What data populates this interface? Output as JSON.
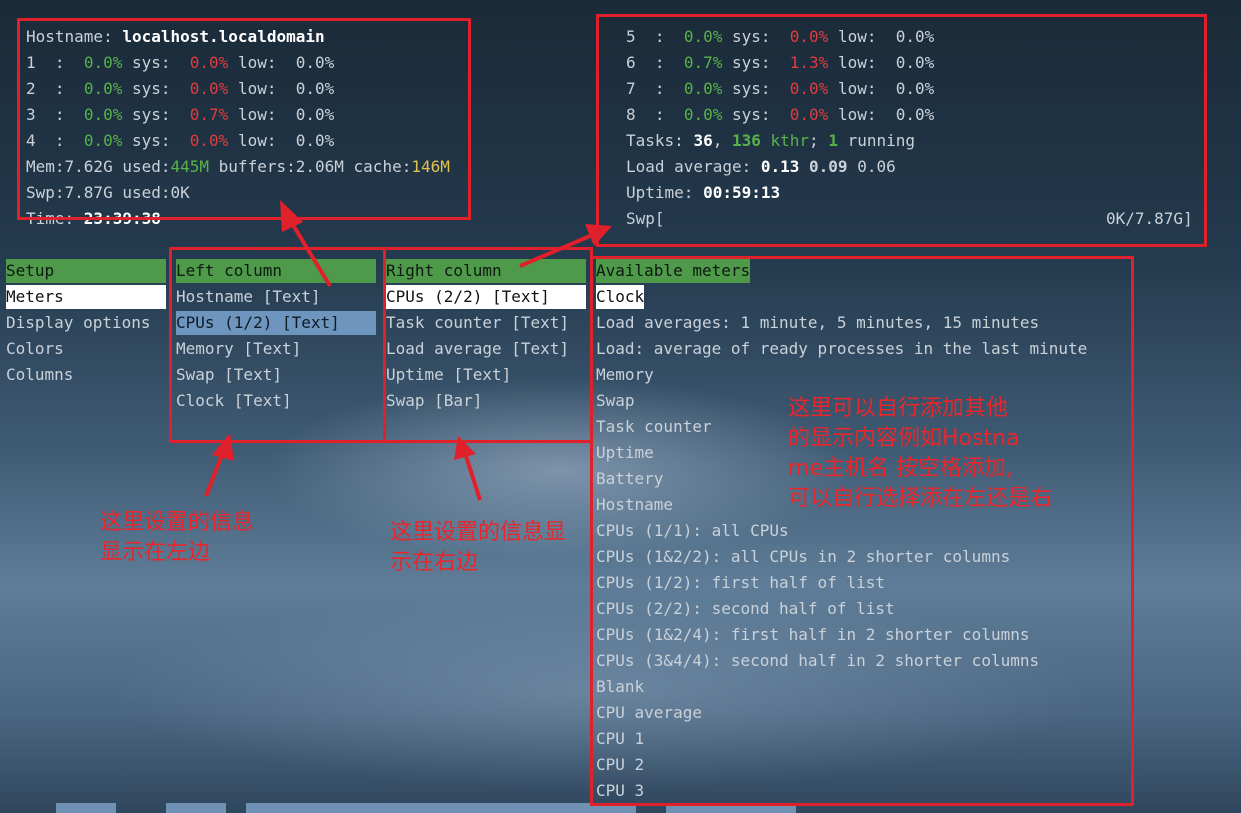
{
  "header_left": {
    "hostname_label": "Hostname: ",
    "hostname": "localhost.localdomain",
    "cpus": [
      {
        "id": "1",
        "usr": "0.0%",
        "sys": "0.0%",
        "low": "0.0%"
      },
      {
        "id": "2",
        "usr": "0.0%",
        "sys": "0.0%",
        "low": "0.0%"
      },
      {
        "id": "3",
        "usr": "0.0%",
        "sys": "0.7%",
        "low": "0.0%"
      },
      {
        "id": "4",
        "usr": "0.0%",
        "sys": "0.0%",
        "low": "0.0%"
      }
    ],
    "mem": {
      "label": "Mem:",
      "total": "7.62G",
      "used_label": " used:",
      "used": "445M",
      "buffers_label": " buffers:",
      "buffers": "2.06M",
      "cache_label": " cache:",
      "cache": "146M"
    },
    "swp": {
      "label": "Swp:",
      "total": "7.87G",
      "used_label": " used:",
      "used": "0K"
    },
    "time": {
      "label": "Time: ",
      "value": "23:39:38"
    }
  },
  "header_right": {
    "cpus": [
      {
        "id": "5",
        "usr": "0.0%",
        "sys": "0.0%",
        "low": "0.0%"
      },
      {
        "id": "6",
        "usr": "0.7%",
        "sys": "1.3%",
        "low": "0.0%"
      },
      {
        "id": "7",
        "usr": "0.0%",
        "sys": "0.0%",
        "low": "0.0%"
      },
      {
        "id": "8",
        "usr": "0.0%",
        "sys": "0.0%",
        "low": "0.0%"
      }
    ],
    "tasks": {
      "label": "Tasks: ",
      "count": "36",
      "sep": ", ",
      "kthr": "136",
      "kthr_label": " kthr",
      "semi": "; ",
      "running": "1",
      "running_label": " running"
    },
    "load": {
      "label": "Load average: ",
      "v1": "0.13",
      "v2": "0.09",
      "v3": "0.06"
    },
    "uptime": {
      "label": "Uptime: ",
      "value": "00:59:13"
    },
    "swp_bar": {
      "label": "Swp[",
      "value": "0K/7.87G]"
    }
  },
  "cpu_labels": {
    "sep": "  :  ",
    "sys": " sys:  ",
    "low": " low:  "
  },
  "setup": {
    "header": "Setup",
    "items": [
      "Meters",
      "Display options",
      "Colors",
      "Columns"
    ]
  },
  "left_column": {
    "header": "Left column",
    "items": [
      "Hostname [Text]",
      "CPUs (1/2) [Text]",
      "Memory [Text]",
      "Swap [Text]",
      "Clock [Text]"
    ]
  },
  "right_column": {
    "header": "Right column",
    "items": [
      "CPUs (2/2) [Text]",
      "Task counter [Text]",
      "Load average [Text]",
      "Uptime [Text]",
      "Swap [Bar]"
    ]
  },
  "available": {
    "header": "Available meters",
    "items": [
      "Clock",
      "Load averages: 1 minute, 5 minutes, 15 minutes",
      "Load: average of ready processes in the last minute",
      "Memory",
      "Swap",
      "Task counter",
      "Uptime",
      "Battery",
      "Hostname",
      "CPUs (1/1): all CPUs",
      "CPUs (1&2/2): all CPUs in 2 shorter columns",
      "CPUs (1/2): first half of list",
      "CPUs (2/2): second half of list",
      "CPUs (1&2/4): first half in 2 shorter columns",
      "CPUs (3&4/4): second half in 2 shorter columns",
      "Blank",
      "CPU average",
      "CPU 1",
      "CPU 2",
      "CPU 3"
    ]
  },
  "annotations": {
    "left_note": "这里设置的信息\n显示在左边",
    "right_note": "这里设置的信息显\n示在右边",
    "meters_note": "这里可以自行添加其他\n的显示内容例如Hostna\nme主机名 按空格添加,\n可以自行选择添在左还是右"
  },
  "colors": {
    "accent_green": "#4e9a4a",
    "annotation_red": "#e0202a",
    "selected_blue": "#6e95be"
  }
}
